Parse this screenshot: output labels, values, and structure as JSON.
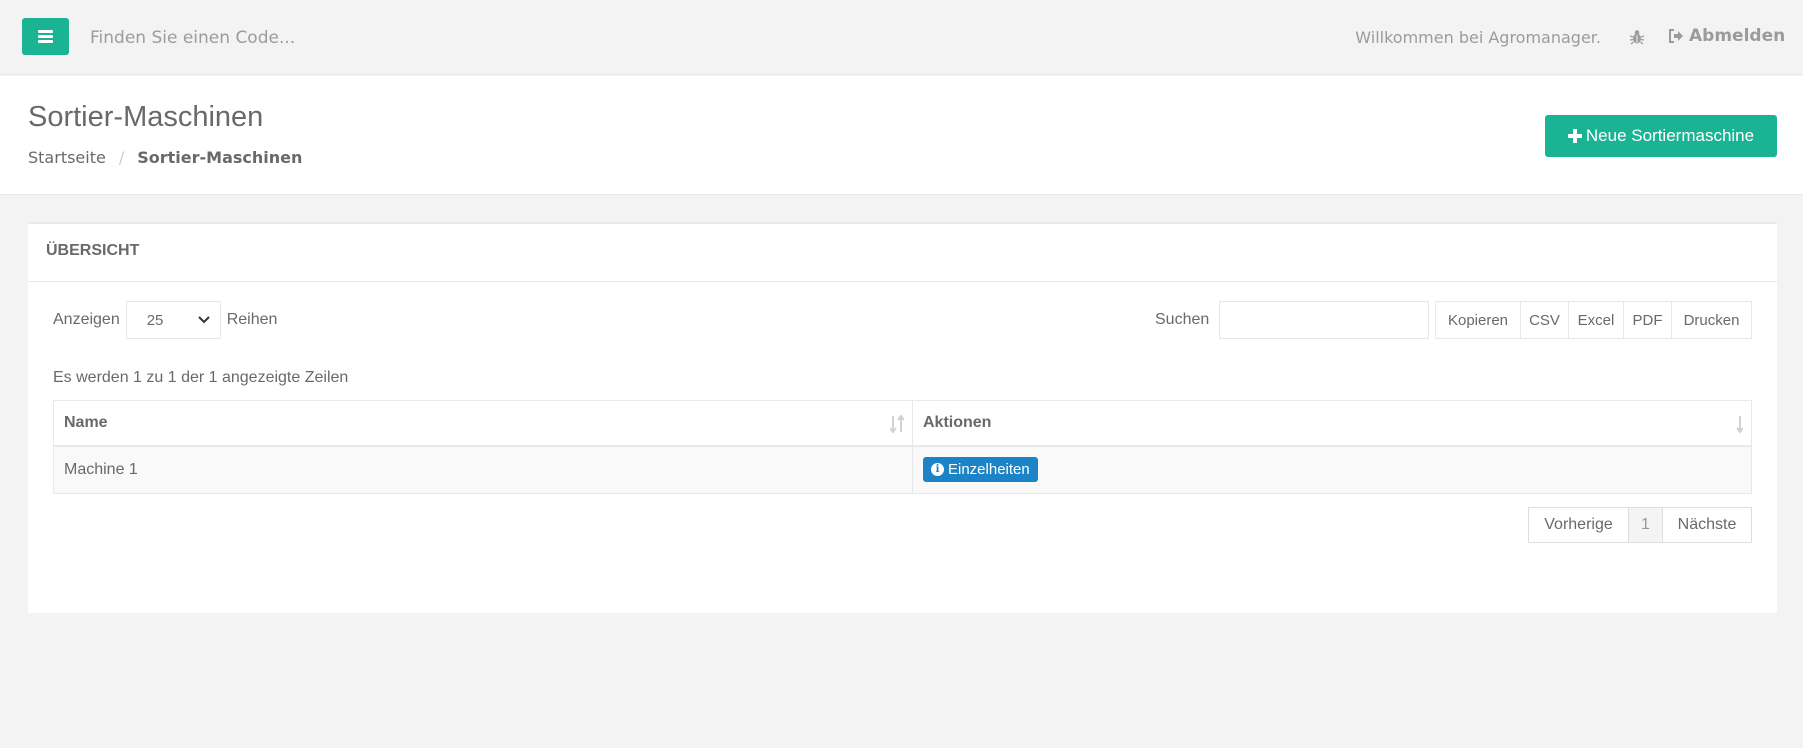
{
  "topbar": {
    "search_placeholder": "Finden Sie einen Code...",
    "welcome": "Willkommen bei Agromanager.",
    "logout": "Abmelden"
  },
  "heading": {
    "title": "Sortier-Maschinen",
    "breadcrumb_home": "Startseite",
    "breadcrumb_sep": "/",
    "breadcrumb_active": "Sortier-Maschinen",
    "new_button": "Neue Sortiermaschine"
  },
  "panel": {
    "title": "ÜBERSICHT",
    "show_label": "Anzeigen",
    "page_size": "25",
    "rows_label": "Reihen",
    "search_label": "Suchen",
    "export_buttons": [
      "Kopieren",
      "CSV",
      "Excel",
      "PDF",
      "Drucken"
    ],
    "info": "Es werden 1 zu 1 der 1 angezeigte Zeilen"
  },
  "table": {
    "columns": [
      "Name",
      "Aktionen"
    ],
    "rows": [
      {
        "name": "Machine 1",
        "action": "Einzelheiten"
      }
    ]
  },
  "pagination": {
    "prev": "Vorherige",
    "current": "1",
    "next": "Nächste"
  },
  "colors": {
    "primary": "#1ab394",
    "info": "#1c84c6",
    "text": "#676a6c"
  },
  "icons": {
    "menu": "bars-icon",
    "bug": "bug-icon",
    "logout": "sign-out-icon",
    "plus": "plus-icon",
    "info": "info-circle-icon",
    "sort": "sort-icon"
  }
}
